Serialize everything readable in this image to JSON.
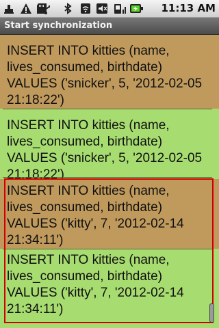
{
  "status_bar": {
    "time": "11:13 AM",
    "icons": [
      "usb-debug-icon",
      "warning-icon",
      "sd-card-icon",
      "usb-icon",
      "bluetooth-icon",
      "wifi-icon",
      "mute-icon",
      "signal-icon",
      "battery-icon"
    ]
  },
  "title_bar": {
    "title": "Start synchronization"
  },
  "list": {
    "items": [
      {
        "text": "INSERT INTO kitties (name,\nlives_consumed, birthdate)\nVALUES ('snicker', 5, '2012-02-05\n21:18:22')",
        "highlighted": true
      },
      {
        "text": "INSERT INTO kitties (name,\nlives_consumed, birthdate)\nVALUES ('snicker', 5, '2012-02-05\n21:18:22')",
        "highlighted": false
      },
      {
        "text": "INSERT INTO kitties (name,\nlives_consumed, birthdate)\nVALUES ('kitty', 7, '2012-02-14\n21:34:11')",
        "highlighted": true
      },
      {
        "text": "INSERT INTO kitties (name,\nlives_consumed, birthdate)\nVALUES ('kitty', 7, '2012-02-14\n21:34:11')",
        "highlighted": false
      }
    ]
  },
  "colors": {
    "background": "#a7dc70",
    "highlight": "#c09a5d",
    "selection_border": "#d00000"
  }
}
